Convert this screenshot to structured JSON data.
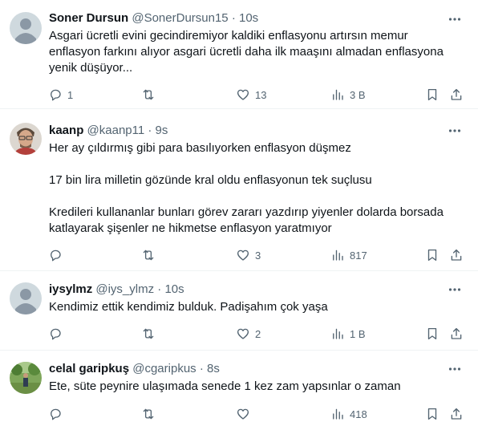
{
  "tweets": [
    {
      "name": "Soner Dursun",
      "handle": "@SonerDursun15",
      "separator": "·",
      "time": "10s",
      "lines": [
        "Asgari ücretli evini gecindiremiyor kaldiki enflasyonu artırsın memur",
        "enflasyon farkını alıyor asgari ücretli daha ilk maaşını almadan enflasyona",
        "yenik düşüyor..."
      ],
      "replies": "1",
      "retweets": "",
      "likes": "13",
      "views": "3 B"
    },
    {
      "name": "kaanp",
      "handle": "@kaanp11",
      "separator": "·",
      "time": "9s",
      "lines": [
        "Her ay çıldırmış gibi para basılıyorken enflasyon düşmez",
        "",
        "17 bin lira milletin gözünde kral oldu enflasyonun tek suçlusu",
        "",
        "Kredileri kullananlar bunları görev zararı yazdırıp yiyenler dolarda borsada",
        "katlayarak şişenler ne hikmetse enflasyon yaratmıyor"
      ],
      "replies": "",
      "retweets": "",
      "likes": "3",
      "views": "817"
    },
    {
      "name": "iysylmz",
      "handle": "@iys_ylmz",
      "separator": "·",
      "time": "10s",
      "lines": [
        "Kendimiz ettik kendimiz bulduk. Padişahım çok yaşa"
      ],
      "replies": "",
      "retweets": "",
      "likes": "2",
      "views": "1 B"
    },
    {
      "name": "celal garipkuş",
      "handle": "@cgaripkus",
      "separator": "·",
      "time": "8s",
      "lines": [
        "Ete, süte peynire ulaşımada senede 1 kez zam yapsınlar o zaman"
      ],
      "replies": "",
      "retweets": "",
      "likes": "",
      "views": "418"
    }
  ],
  "icons": {
    "more": "more-horizontal-icon",
    "reply": "reply-icon",
    "retweet": "retweet-icon",
    "like": "heart-icon",
    "views": "views-chart-icon",
    "bookmark": "bookmark-icon",
    "share": "share-icon"
  },
  "colors": {
    "text": "#0f1419",
    "secondary": "#536471",
    "divider": "#eff3f4",
    "default_avatar_bg": "#cfd9de"
  }
}
